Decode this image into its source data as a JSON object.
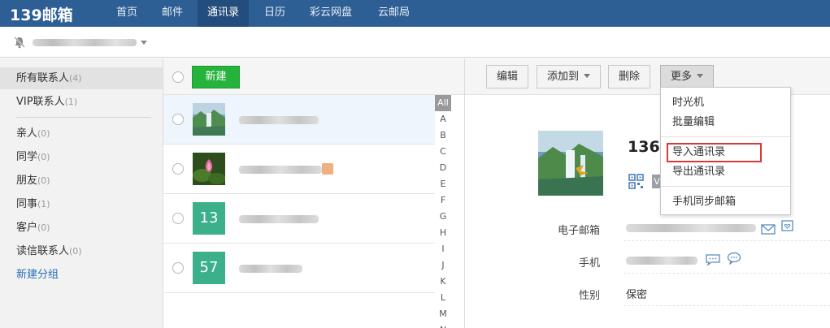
{
  "topnav": {
    "logo": "139邮箱",
    "items": [
      "首页",
      "邮件",
      "通讯录",
      "日历",
      "彩云网盘",
      "云邮局"
    ],
    "active_index": 2
  },
  "sidebar": {
    "groups": [
      {
        "label": "所有联系人",
        "count": "(4)"
      },
      {
        "label": "VIP联系人",
        "count": "(1)"
      },
      {
        "label": "亲人",
        "count": "(0)"
      },
      {
        "label": "同学",
        "count": "(0)"
      },
      {
        "label": "朋友",
        "count": "(0)"
      },
      {
        "label": "同事",
        "count": "(1)"
      },
      {
        "label": "客户",
        "count": "(0)"
      },
      {
        "label": "读信联系人",
        "count": "(0)"
      }
    ],
    "new_group": "新建分组"
  },
  "list": {
    "new_button": "新建",
    "rows": [
      {
        "avatar": "landscape",
        "avatar_text": ""
      },
      {
        "avatar": "lotus",
        "avatar_text": ""
      },
      {
        "avatar": "number",
        "avatar_text": "13"
      },
      {
        "avatar": "number",
        "avatar_text": "57"
      }
    ],
    "alphabet": [
      "All",
      "A",
      "B",
      "C",
      "D",
      "E",
      "F",
      "G",
      "H",
      "I",
      "J",
      "K",
      "L",
      "M",
      "N"
    ]
  },
  "toolbar": {
    "edit": "编辑",
    "add_to": "添加到",
    "delete": "删除",
    "more": "更多"
  },
  "more_menu": {
    "items": [
      "时光机",
      "批量编辑",
      "导入通讯录",
      "导出通讯录",
      "手机同步邮箱"
    ],
    "highlighted": "导入通讯录"
  },
  "detail": {
    "name": "136",
    "v_badge": "V",
    "fields": {
      "email_label": "电子邮箱",
      "phone_label": "手机",
      "gender_label": "性别",
      "gender_value": "保密"
    }
  },
  "colors": {
    "topbar": "#2d5f95",
    "new_button": "#25b33c",
    "number_avatar": "#3bb08a",
    "highlight_border": "#d9383a",
    "link": "#2a6eb6"
  }
}
